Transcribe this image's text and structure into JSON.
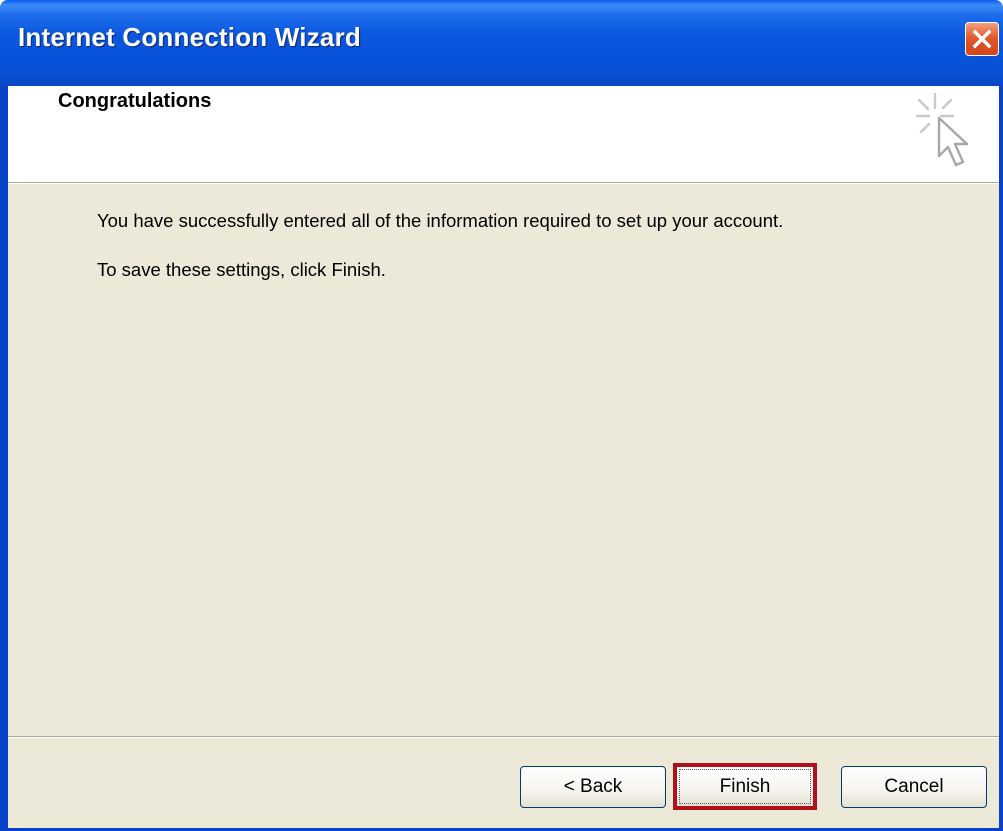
{
  "window": {
    "title": "Internet Connection Wizard",
    "close_icon": "close-icon"
  },
  "header": {
    "title": "Congratulations",
    "icon": "wizard-cursor-sparkle-icon"
  },
  "body": {
    "line1": "You have successfully entered all of the information required to set up your account.",
    "line2": "To save these settings, click Finish."
  },
  "buttons": {
    "back_label": "< Back",
    "finish_label": "Finish",
    "cancel_label": "Cancel"
  },
  "colors": {
    "titlebar": "#0a57e0",
    "dialog_background": "#ece9d8",
    "highlight_border": "#b0121c",
    "close_button": "#e05a2c"
  }
}
